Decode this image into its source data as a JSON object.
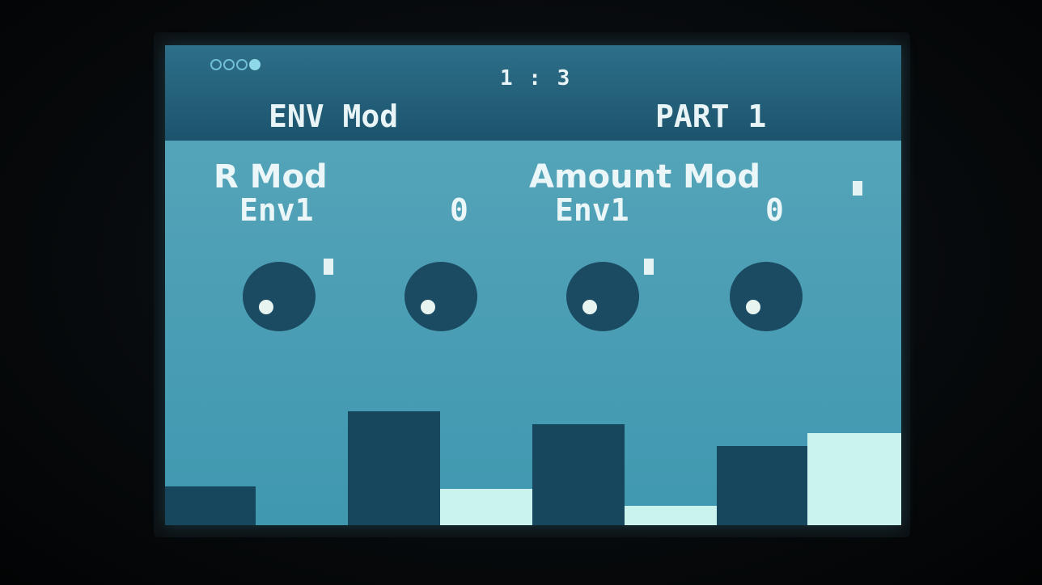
{
  "screen": {
    "page_indicator": "1 : 3",
    "page_dots": [
      "empty",
      "empty",
      "empty",
      "filled"
    ],
    "title": "ENV Mod",
    "part": "PART 1"
  },
  "params": [
    {
      "label": "R Mod",
      "source": "Env1",
      "value": "0"
    },
    {
      "label": "Amount Mod",
      "source": "Env1",
      "value": "0"
    }
  ],
  "colors": {
    "screen_bg": "#4fa0b6",
    "topbar_bg": "#24607a",
    "knob": "#1b4b62",
    "text": "#e8f4f6",
    "bar_dark": "#17475d",
    "bar_light": "#c9f3ec"
  }
}
